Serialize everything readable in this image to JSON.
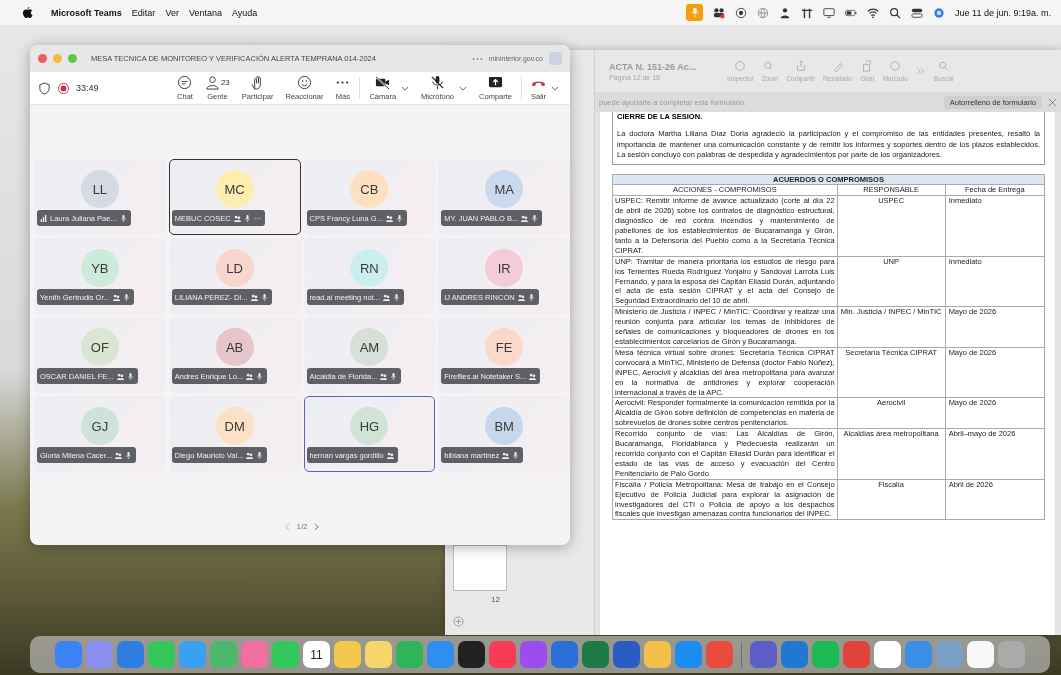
{
  "menu_bar": {
    "app_name": "Microsoft Teams",
    "menus": [
      "Editar",
      "Ver",
      "Ventana",
      "Ayuda"
    ],
    "clock": "Jue 11 de jun. 9:19a. m."
  },
  "teams": {
    "title": "MESA TECNICA DE MONITOREO Y VERIFICACIÓN ALERTA TEMPRANA 014-2024",
    "domain": "mininterior.gov.co",
    "timer": "33:49",
    "people_count": "23",
    "toolbar": [
      {
        "kind": "chat",
        "label": "Chat",
        "dropdown": false
      },
      {
        "kind": "people",
        "label": "Gente",
        "dropdown": false
      },
      {
        "kind": "hand",
        "label": "Participar",
        "dropdown": false
      },
      {
        "kind": "react",
        "label": "Reaccionar",
        "dropdown": false
      },
      {
        "kind": "more",
        "label": "Más",
        "dropdown": false
      },
      {
        "kind": "camera",
        "label": "Cámara",
        "dropdown": true
      },
      {
        "kind": "mic",
        "label": "Micrófono",
        "dropdown": true
      },
      {
        "kind": "share",
        "label": "Comparte",
        "dropdown": false
      },
      {
        "kind": "leave",
        "label": "Salir",
        "dropdown": true
      }
    ],
    "participants": [
      {
        "initials": "LL",
        "name": "Laura Juliana Pae...",
        "color": "#d5dbe3",
        "signal": true,
        "group_icon": false,
        "mic_icon": true,
        "more": false,
        "pinned": false,
        "speaking": false
      },
      {
        "initials": "MC",
        "name": "MEBUC COSEC",
        "color": "#fbeeb0",
        "signal": false,
        "group_icon": true,
        "mic_icon": true,
        "more": true,
        "pinned": true,
        "speaking": false
      },
      {
        "initials": "CB",
        "name": "CPS Francy Luna G...",
        "color": "#fde0c0",
        "signal": false,
        "group_icon": true,
        "mic_icon": true,
        "more": false,
        "pinned": false,
        "speaking": false
      },
      {
        "initials": "MA",
        "name": "MY. JUAN PABLO B...",
        "color": "#c9d9ef",
        "signal": false,
        "group_icon": true,
        "mic_icon": true,
        "more": false,
        "pinned": false,
        "speaking": false
      },
      {
        "initials": "YB",
        "name": "Yenith Gertrudis Or...",
        "color": "#cdebdc",
        "signal": false,
        "group_icon": true,
        "mic_icon": true,
        "more": false,
        "pinned": false,
        "speaking": false
      },
      {
        "initials": "LD",
        "name": "LILIANA PEREZ- DI...",
        "color": "#f8d6cf",
        "signal": false,
        "group_icon": true,
        "mic_icon": true,
        "more": false,
        "pinned": false,
        "speaking": false
      },
      {
        "initials": "RN",
        "name": "read.ai meeting not...",
        "color": "#cdeef0",
        "signal": false,
        "group_icon": true,
        "mic_icon": true,
        "more": false,
        "pinned": false,
        "speaking": false
      },
      {
        "initials": "IR",
        "name": "IJ ANDRES RINCON",
        "color": "#f4cbd8",
        "signal": false,
        "group_icon": true,
        "mic_icon": true,
        "more": false,
        "pinned": false,
        "speaking": false
      },
      {
        "initials": "OF",
        "name": "OSCAR DANIEL FE...",
        "color": "#dbe6d2",
        "signal": false,
        "group_icon": true,
        "mic_icon": true,
        "more": false,
        "pinned": false,
        "speaking": false
      },
      {
        "initials": "AB",
        "name": "Andres Enrique Lo...",
        "color": "#e8c4cc",
        "signal": false,
        "group_icon": true,
        "mic_icon": true,
        "more": false,
        "pinned": false,
        "speaking": false
      },
      {
        "initials": "AM",
        "name": "Alcaldia de Florida...",
        "color": "#d6e0d8",
        "signal": false,
        "group_icon": true,
        "mic_icon": true,
        "more": false,
        "pinned": false,
        "speaking": false
      },
      {
        "initials": "FE",
        "name": "Fireflies.ai Notetaker S...",
        "color": "#fbd9c8",
        "signal": false,
        "group_icon": true,
        "mic_icon": false,
        "more": false,
        "pinned": false,
        "speaking": false
      },
      {
        "initials": "GJ",
        "name": "Gloria Milena Cacer...",
        "color": "#cfe2da",
        "signal": false,
        "group_icon": true,
        "mic_icon": true,
        "more": false,
        "pinned": false,
        "speaking": false
      },
      {
        "initials": "DM",
        "name": "Diego Mauricio Val...",
        "color": "#fde1c4",
        "signal": false,
        "group_icon": true,
        "mic_icon": true,
        "more": false,
        "pinned": false,
        "speaking": false
      },
      {
        "initials": "HG",
        "name": "hernan vargas gordillo",
        "color": "#d1e3d6",
        "signal": false,
        "group_icon": true,
        "mic_icon": false,
        "more": false,
        "pinned": false,
        "speaking": true
      },
      {
        "initials": "BM",
        "name": "bibiana martinez",
        "color": "#c6d7ec",
        "signal": false,
        "group_icon": true,
        "mic_icon": true,
        "more": false,
        "pinned": false,
        "speaking": false
      }
    ],
    "pager": "1/2"
  },
  "document": {
    "title": "ACTA N. 151-26 Ac...",
    "subtitle": "Página 12 de 18",
    "toolbar": [
      {
        "kind": "info",
        "label": "Inspector"
      },
      {
        "kind": "zoom",
        "label": "Zoom"
      },
      {
        "kind": "share",
        "label": "Compartir"
      },
      {
        "kind": "highlight",
        "label": "Resaltado"
      },
      {
        "kind": "rotate",
        "label": "Girar"
      },
      {
        "kind": "markup",
        "label": "Marcado"
      },
      {
        "kind": "search",
        "label": "Buscar"
      }
    ],
    "banner": "puede ayudarte a completar este formulario.",
    "banner_button": "Autorrelleno de formulario",
    "thumbnail_page": "12",
    "section_heading": "CIERRE DE LA SESION.",
    "paragraph": "La doctora Martha Liliana Díaz Doria agradeció la participación y el compromiso de las entidades presentes, resaltó la importancia de mantener una comunicación constante y de remitir los informes y soportes dentro de los plazos establecidos. La sesión concluyó con palabras de despedida y agradecimientos por parte de los organizadores.",
    "table": {
      "title": "ACUERDOS O COMPROMISOS",
      "columns": [
        "ACCIONES - COMPROMISOS",
        "RESPONSABLE",
        "Fecha de Entrega"
      ],
      "rows": [
        [
          "USPEC: Remitir informe de avance actualizado (corte al día 22 de abril de 2026) sobre los contratos de diagnóstico estructural, diagnóstico de red contra incendios y mantenimiento de pabellones de los establecimientos de Bucaramanga y Girón, tanto a la Defensoría del Pueblo como a la Secretaría Técnica CIPRAT.",
          "USPEC",
          "Inmediato"
        ],
        [
          "UNP: Tramitar de manera prioritaria los estudios de riesgo para los Tenientes Rueda Rodríguez Yonjairo y Sandoval Larrota Luis Fernando, y para la esposa del Capitán Eliasid Durán, adjuntando el acta de esta sesión CIPRAT y el acta del Consejo de Seguridad Extraordinario del 10 de abril.",
          "UNP",
          "Inmediato"
        ],
        [
          "Ministerio de Justicia / INPEC / MinTIC: Coordinar y realizar una reunión conjunta para articular los temas de inhibidores de señales de comunicaciones y bloqueadores de drones en los establecimientos carcelarios de Girón y Bucaramanga.",
          "Min. Justicia / INPEC / MinTIC",
          "Mayo de 2026"
        ],
        [
          "Mesa técnica virtual sobre drones: Secretaría Técnica CIPRAT convocará a MinTIC, Ministerio de Defensa (doctor Fabio Núñez), INPEC, Aerocivil y alcaldías del área metropolitana para avanzar en la normativa de antidrones y explorar cooperación internacional a través de la APC.",
          "Secretaría Técnica CIPRAT",
          "Mayo de 2026"
        ],
        [
          "Aerocivil: Responder formalmente la comunicación remitida por la Alcaldía de Girón sobre definición de competencias en materia de sobrevuelos de drones sobre centros penitenciarios.",
          "Aerocivil",
          "Mayo de 2026"
        ],
        [
          "Recorrido conjunto de vías: Las Alcaldías de Girón, Bucaramanga, Floridablanca y Piedecuesta realizarán un recorrido conjunto con el Capitán Eliasid Durán para identificar el estado de las vías de acceso y evacuación del Centro Penitenciario de Palo Gordo.",
          "Alcaldías área metropolitana",
          "Abril–mayo de 2026"
        ],
        [
          "Fiscalía / Policía Metropolitana: Mesa de trabajo en el Consejo Ejecutivo de Policía Judicial para explorar la asignación de investigadores del CTI o Policía de apoyo a los despachos fiscales que investigan amenazas contra funcionarios del INPEC.",
          "Fiscalía",
          "Abril de 2026"
        ]
      ]
    }
  },
  "dock": {
    "calendar_day": "11"
  }
}
